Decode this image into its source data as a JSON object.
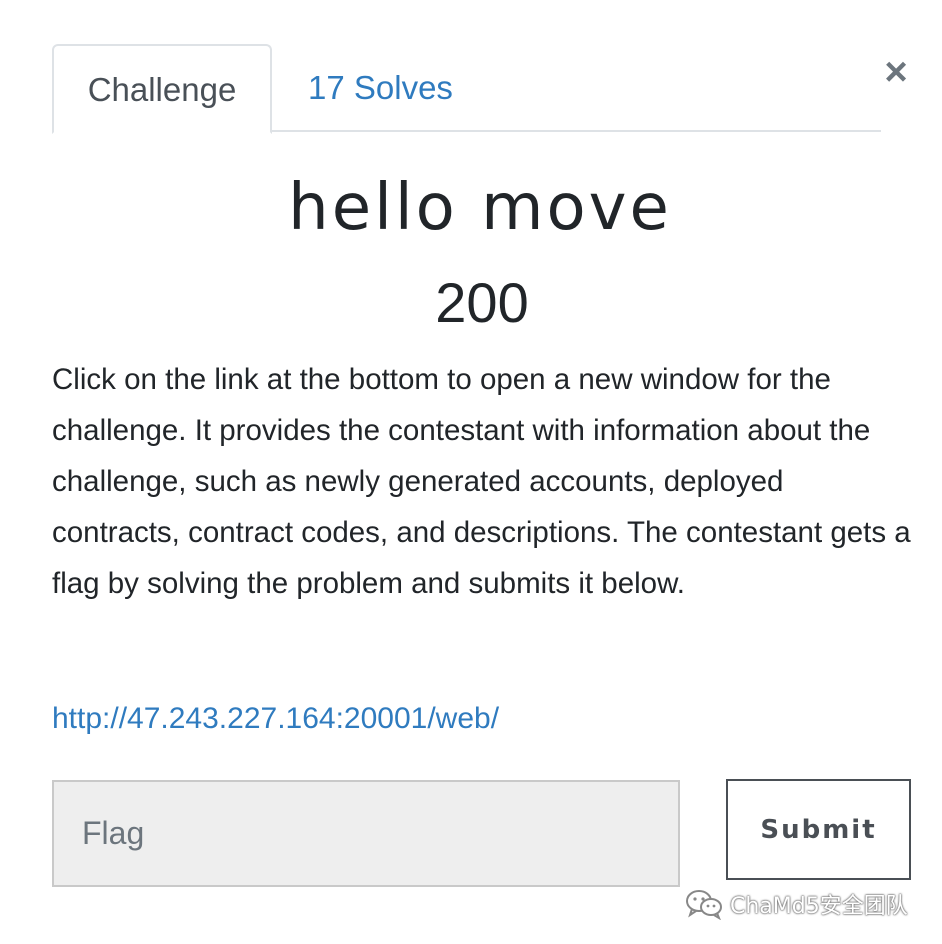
{
  "modal": {
    "close_glyph": "×",
    "tabs": [
      {
        "label": "Challenge",
        "active": true
      },
      {
        "label": "17 Solves",
        "active": false
      }
    ],
    "challenge": {
      "title": "hello move",
      "points": "200",
      "description": "Click on the link at the bottom to open a new window for the challenge. It provides the contestant with information about the challenge, such as newly generated accounts, deployed contracts, contract codes, and descriptions. The contestant gets a flag by solving the problem and submits it below.",
      "link": "http://47.243.227.164:20001/web/"
    },
    "form": {
      "flag_placeholder": "Flag",
      "flag_value": "",
      "submit_label": "Submit"
    }
  },
  "watermark": {
    "icon": "wechat-icon",
    "text": "ChaMd5安全团队"
  },
  "colors": {
    "link": "#2f7bbf",
    "text": "#212529",
    "tab_border": "#dee2e6",
    "input_bg": "#eeeeee",
    "close": "#6c757d"
  }
}
